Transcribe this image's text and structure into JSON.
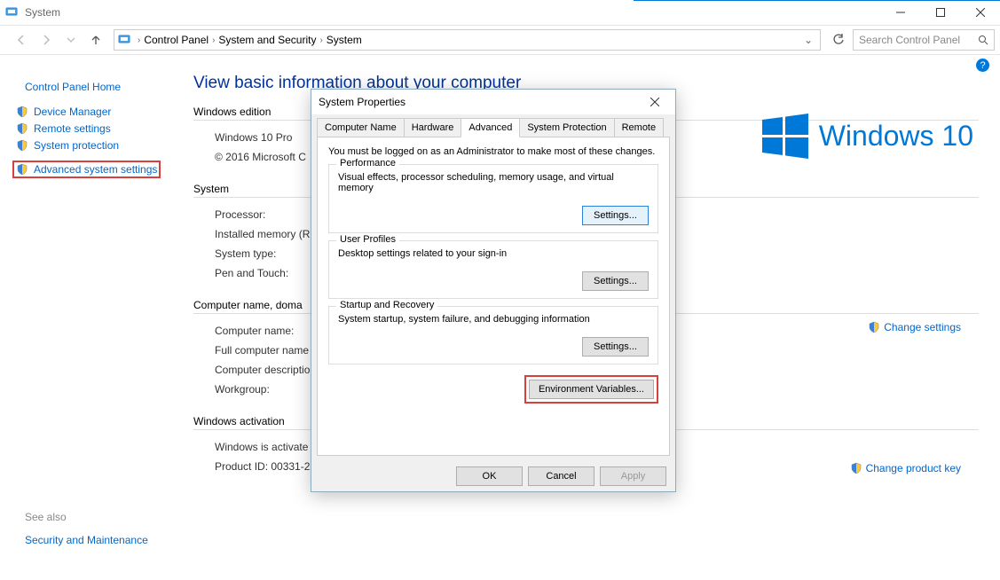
{
  "titlebar": {
    "title": "System"
  },
  "nav": {
    "breadcrumb": [
      "Control Panel",
      "System and Security",
      "System"
    ],
    "search_placeholder": "Search Control Panel"
  },
  "sidebar": {
    "home": "Control Panel Home",
    "items": [
      {
        "label": "Device Manager"
      },
      {
        "label": "Remote settings"
      },
      {
        "label": "System protection"
      },
      {
        "label": "Advanced system settings",
        "highlighted": true
      }
    ],
    "see_also": "See also",
    "bottom": "Security and Maintenance"
  },
  "main": {
    "heading": "View basic information about your computer",
    "edition": {
      "title": "Windows edition",
      "lines": [
        "Windows 10 Pro",
        "© 2016 Microsoft C"
      ]
    },
    "windows_brand": "Windows 10",
    "system": {
      "title": "System",
      "rows": [
        "Processor:",
        "Installed memory (R",
        "System type:",
        "Pen and Touch:"
      ]
    },
    "computer": {
      "title": "Computer name, doma",
      "rows": [
        "Computer name:",
        "Full computer name",
        "Computer descriptio",
        "Workgroup:"
      ],
      "action": "Change settings"
    },
    "activation": {
      "title": "Windows activation",
      "rows": [
        "Windows is activate",
        "Product ID: 00331-2"
      ],
      "action": "Change product key"
    }
  },
  "dialog": {
    "title": "System Properties",
    "tabs": [
      "Computer Name",
      "Hardware",
      "Advanced",
      "System Protection",
      "Remote"
    ],
    "active_tab": 2,
    "admin_note": "You must be logged on as an Administrator to make most of these changes.",
    "groups": [
      {
        "title": "Performance",
        "desc": "Visual effects, processor scheduling, memory usage, and virtual memory",
        "button": "Settings...",
        "focused": true
      },
      {
        "title": "User Profiles",
        "desc": "Desktop settings related to your sign-in",
        "button": "Settings..."
      },
      {
        "title": "Startup and Recovery",
        "desc": "System startup, system failure, and debugging information",
        "button": "Settings..."
      }
    ],
    "env_button": "Environment Variables...",
    "buttons": {
      "ok": "OK",
      "cancel": "Cancel",
      "apply": "Apply"
    }
  }
}
